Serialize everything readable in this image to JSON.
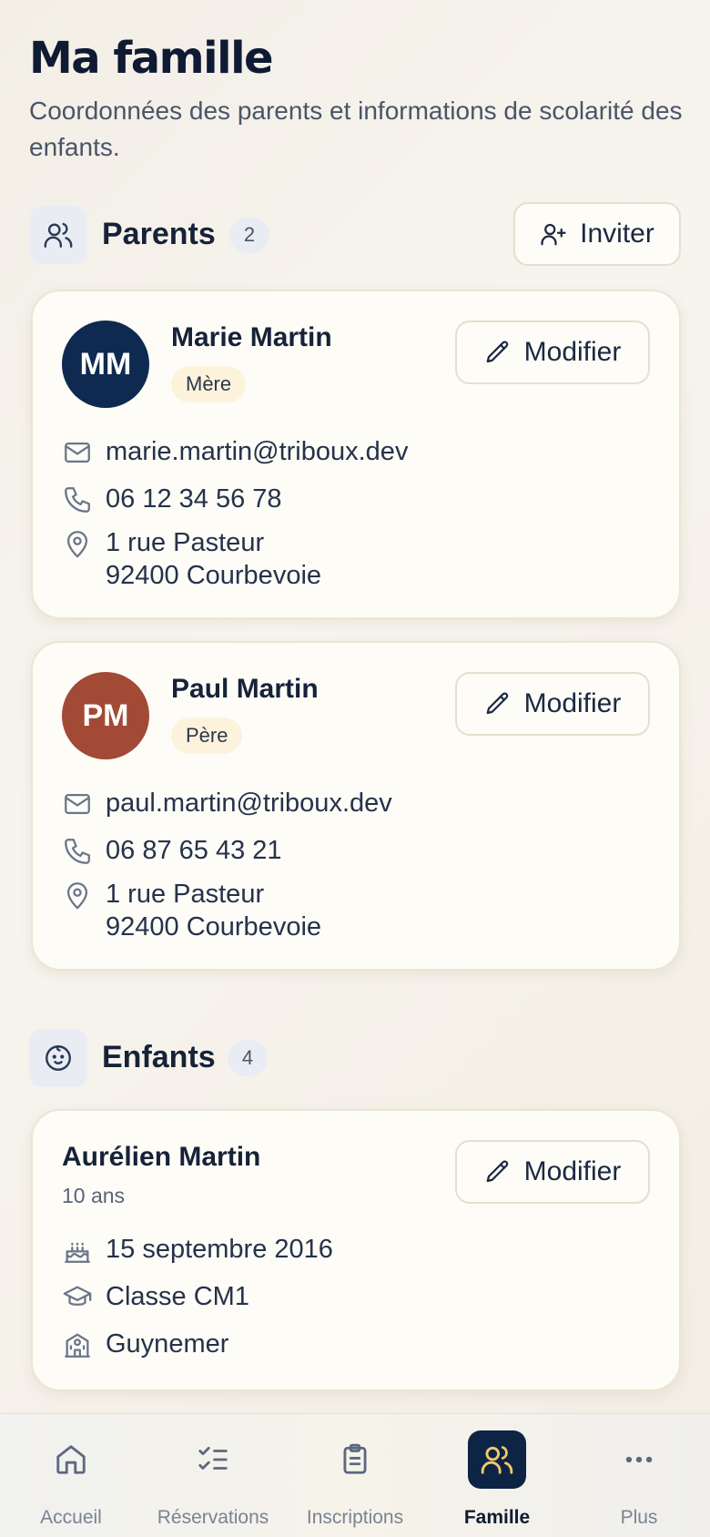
{
  "header": {
    "title": "Ma famille",
    "subtitle": "Coordonnées des parents et informations de scolarité des enfants."
  },
  "parents_section": {
    "title": "Parents",
    "count": "2",
    "icon": "users-icon",
    "invite_label": "Inviter",
    "parents": [
      {
        "initials": "MM",
        "avatar_color": "#0e2a50",
        "name": "Marie Martin",
        "role": "Mère",
        "edit_label": "Modifier",
        "email": "marie.martin@triboux.dev",
        "phone": "06 12 34 56 78",
        "address_line1": "1 rue Pasteur",
        "address_line2": "92400 Courbevoie"
      },
      {
        "initials": "PM",
        "avatar_color": "#a24a36",
        "name": "Paul Martin",
        "role": "Père",
        "edit_label": "Modifier",
        "email": "paul.martin@triboux.dev",
        "phone": "06 87 65 43 21",
        "address_line1": "1 rue Pasteur",
        "address_line2": "92400 Courbevoie"
      }
    ]
  },
  "children_section": {
    "title": "Enfants",
    "count": "4",
    "icon": "baby-face-icon",
    "children": [
      {
        "name": "Aurélien Martin",
        "age": "10 ans",
        "edit_label": "Modifier",
        "birthday": "15 septembre 2016",
        "class": "Classe CM1",
        "school": "Guynemer"
      }
    ]
  },
  "tabbar": {
    "tabs": [
      {
        "label": "Accueil",
        "icon": "home-icon",
        "active": false
      },
      {
        "label": "Réservations",
        "icon": "checklist-icon",
        "active": false
      },
      {
        "label": "Inscriptions",
        "icon": "clipboard-icon",
        "active": false
      },
      {
        "label": "Famille",
        "icon": "users-icon",
        "active": true
      },
      {
        "label": "Plus",
        "icon": "more-dots-icon",
        "active": false
      }
    ],
    "active_color": "#0e2445",
    "active_icon_color": "#f3c86a"
  },
  "colors": {
    "background": "#f5f1e9",
    "card": "#fdfcf7",
    "text_primary": "#162238",
    "badge_role": "#fdf3dd"
  }
}
